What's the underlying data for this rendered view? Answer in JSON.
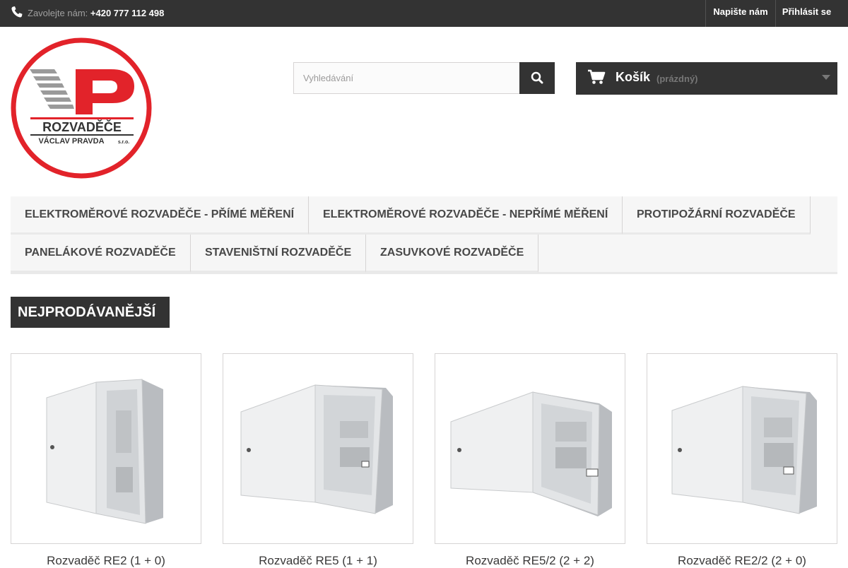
{
  "topbar": {
    "phone_prefix": "Zavolejte nám:",
    "phone_number": "+420 777 112 498",
    "contact_label": "Napište nám",
    "login_label": "Přihlásit se"
  },
  "logo": {
    "initials": "VP",
    "line1": "ROZVADĚČE",
    "line2": "VÁCLAV PRAVDA",
    "line2_suffix": "s.r.o."
  },
  "search": {
    "placeholder": "Vyhledávání"
  },
  "cart": {
    "label": "Košík",
    "state": "(prázdný)"
  },
  "menu": {
    "items": [
      "ELEKTROMĚROVÉ ROZVADĚČE - PŘÍMÉ MĚŘENÍ",
      "ELEKTROMĚROVÉ ROZVADĚČE - NEPŘÍMÉ MĚŘENÍ",
      "PROTIPOŽÁRNÍ ROZVADĚČE",
      "PANELÁKOVÉ ROZVADĚČE",
      "STAVENIŠTNÍ ROZVADĚČE",
      "ZASUVKOVÉ ROZVADĚČE"
    ]
  },
  "section": {
    "title": "NEJPRODÁVANĚJŠÍ"
  },
  "products": [
    {
      "name": "Rozvaděč RE2 (1 + 0)"
    },
    {
      "name": "Rozvaděč RE5 (1 + 1)"
    },
    {
      "name": "Rozvaděč RE5/2 (2 + 2)"
    },
    {
      "name": "Rozvaděč RE2/2 (2 + 0)"
    }
  ],
  "colors": {
    "dark": "#333333",
    "brand_red": "#e2232a",
    "brand_grey": "#9a9a9a"
  }
}
